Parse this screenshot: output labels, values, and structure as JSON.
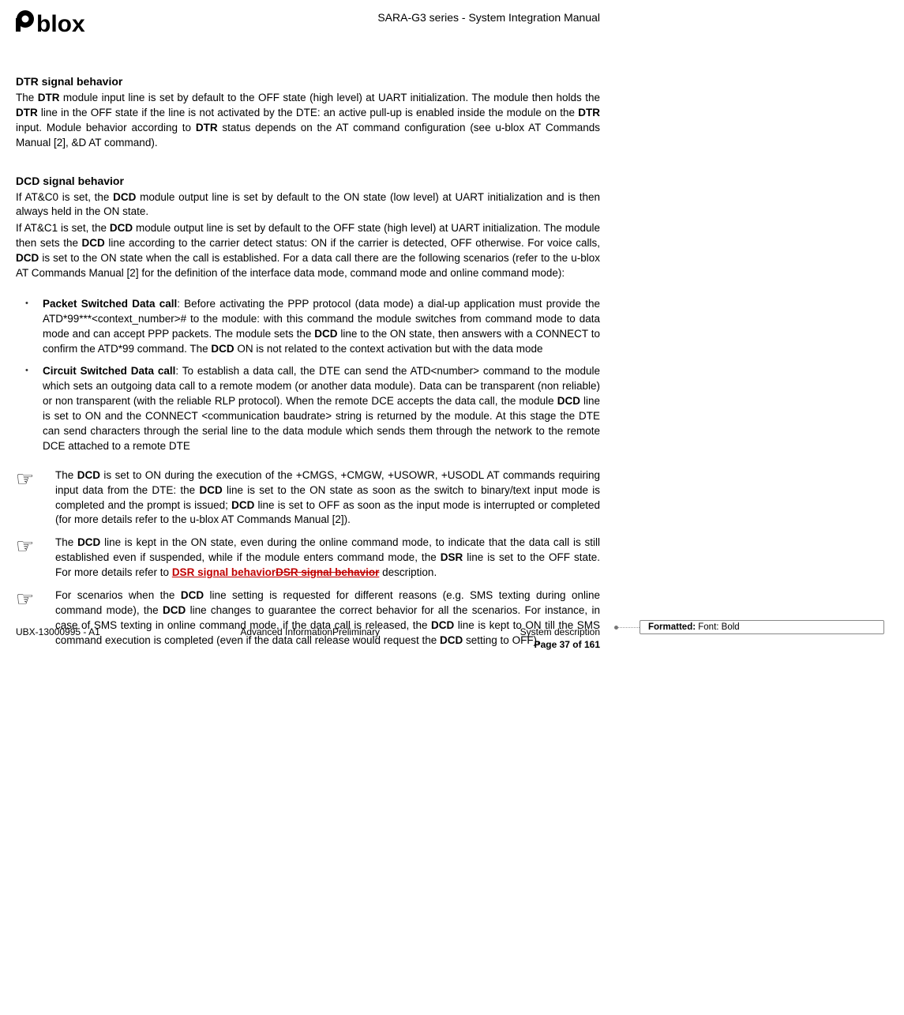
{
  "header": {
    "doc_title": "SARA-G3 series - System Integration Manual"
  },
  "s1": {
    "head": "DTR signal behavior",
    "p1a": "The ",
    "p1b": "DTR",
    "p1c": " module input line is set by default to the OFF state (high level) at UART initialization. The module then holds the ",
    "p1d": "DTR",
    "p1e": " line in the OFF state if the line is not activated by the DTE: an active pull-up is enabled inside the module on the ",
    "p1f": "DTR",
    "p1g": " input. Module behavior according to ",
    "p1h": "DTR",
    "p1i": " status depends on the AT command configuration (see u-blox AT Commands Manual [2], &D AT command)."
  },
  "s2": {
    "head": "DCD signal behavior",
    "p1a": "If AT&C0 is set, the ",
    "p1b": "DCD",
    "p1c": " module output line is set by default to the ON state (low level) at UART initialization and is then always held in the ON state.",
    "p2a": "If AT&C1 is set, the ",
    "p2b": "DCD",
    "p2c": " module output line is set by default to the OFF state (high level) at UART initialization. The module then sets the ",
    "p2d": "DCD",
    "p2e": " line according to the carrier detect status: ON if the carrier is detected, OFF otherwise. For voice calls, ",
    "p2f": "DCD",
    "p2g": " is set to the ON state when the call is established. For a data call there are the following scenarios (refer to the u-blox AT Commands Manual [2] for the definition of the interface data mode, command mode and online command mode):"
  },
  "bul": {
    "l1a": "Packet Switched Data call",
    "l1b": ": Before activating the PPP protocol (data mode) a dial-up application must provide the ATD*99***<context_number># to the module: with this command the module switches from command mode to data mode and can accept PPP packets. The module sets the ",
    "l1c": "DCD",
    "l1d": " line to the ON state, then answers with a CONNECT to confirm the ATD*99 command. The ",
    "l1e": "DCD",
    "l1f": " ON is not related to the context activation but with the data mode",
    "l2a": "Circuit Switched Data call",
    "l2b": ": To establish a data call, the DTE can send the ATD<number> command to the module which sets an outgoing data call to a remote modem (or another data module). Data can be transparent (non reliable) or non transparent (with the reliable RLP protocol). When the remote DCE accepts the data call, the module ",
    "l2c": "DCD",
    "l2d": " line is set to ON and the CONNECT <communication baudrate> string is returned by the module. At this stage the DTE can send characters through the serial line to the data module which sends them through the network to the remote DCE attached to a remote DTE"
  },
  "n1": {
    "a": "The ",
    "b": "DCD",
    "c": " is set to ON during the execution of the +CMGS, +CMGW, +USOWR, +USODL AT commands requiring input data from the DTE: the ",
    "d": "DCD",
    "e": " line is set to the ON state as soon as the switch to binary/text input mode is completed and the prompt is issued; ",
    "f": "DCD",
    "g": " line is set to OFF as soon as the input mode is interrupted or completed (for more details refer to the u-blox AT Commands Manual [2])."
  },
  "n2": {
    "a": "The ",
    "b": "DCD",
    "c": " line is kept in the ON state, even during the online command mode, to indicate that the data call is still established even if suspended, while if the module enters command mode, the ",
    "d": "DSR",
    "e": " line is set to the OFF state. For more details refer to ",
    "ins_new": "DSR signal behavior",
    "ins_old": "DSR signal behavior",
    "f": " description."
  },
  "n3": {
    "a": "For scenarios when the ",
    "b": "DCD",
    "c": " line setting is requested for different reasons (e.g. SMS texting during online command mode), the ",
    "d": "DCD",
    "e": " line changes to guarantee the correct behavior for all the scenarios. For instance, in case of SMS texting in online command mode, if the data call is released, the ",
    "f": "DCD",
    "g": " line is kept to ON till the SMS command execution is completed (even if the data call release would request the ",
    "h": "DCD",
    "i": " setting to OFF)."
  },
  "balloon": {
    "label": "Formatted:",
    "text": " Font: Bold"
  },
  "footer": {
    "left": "UBX-13000995 - A1",
    "center": "Advanced InformationPreliminary",
    "right": "System description",
    "page": "Page 37 of 161"
  }
}
